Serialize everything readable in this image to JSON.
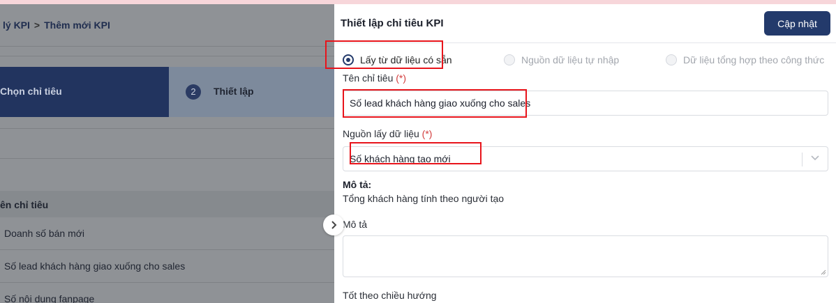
{
  "breadcrumb": {
    "parent": "lý KPI",
    "separator": ">",
    "current": "Thêm mới KPI"
  },
  "steps": [
    {
      "label": "Chọn chỉ tiêu"
    },
    {
      "number": "2",
      "label": "Thiết lập"
    }
  ],
  "list": {
    "header": "ên chỉ tiêu",
    "rows": [
      "Doanh số bán mới",
      "Số lead khách hàng giao xuống cho sales",
      "Số nội dung fanpage"
    ]
  },
  "panel": {
    "title": "Thiết lập chỉ tiêu KPI",
    "update_label": "Cập nhật",
    "source_options": [
      {
        "label": "Lấy từ dữ liệu có sẵn",
        "checked": true
      },
      {
        "label": "Nguồn dữ liệu tự nhập",
        "checked": false
      },
      {
        "label": "Dữ liệu tổng hợp theo công thức",
        "checked": false
      }
    ],
    "name_field": {
      "label": "Tên chỉ tiêu",
      "required_mark": "(*)",
      "value": "Số lead khách hàng giao xuống cho sales"
    },
    "source_field": {
      "label": "Nguồn lấy dữ liệu",
      "required_mark": "(*)",
      "value": "Số khách hàng tạo mới"
    },
    "description": {
      "title": "Mô tả:",
      "text": "Tổng khách hàng tính theo người tạo"
    },
    "note_field": {
      "label": "Mô tả",
      "value": ""
    },
    "direction_label": "Tốt theo chiều hướng"
  },
  "colors": {
    "primary": "#233a6b",
    "required": "#d23b3b",
    "highlight": "#e8141b"
  }
}
